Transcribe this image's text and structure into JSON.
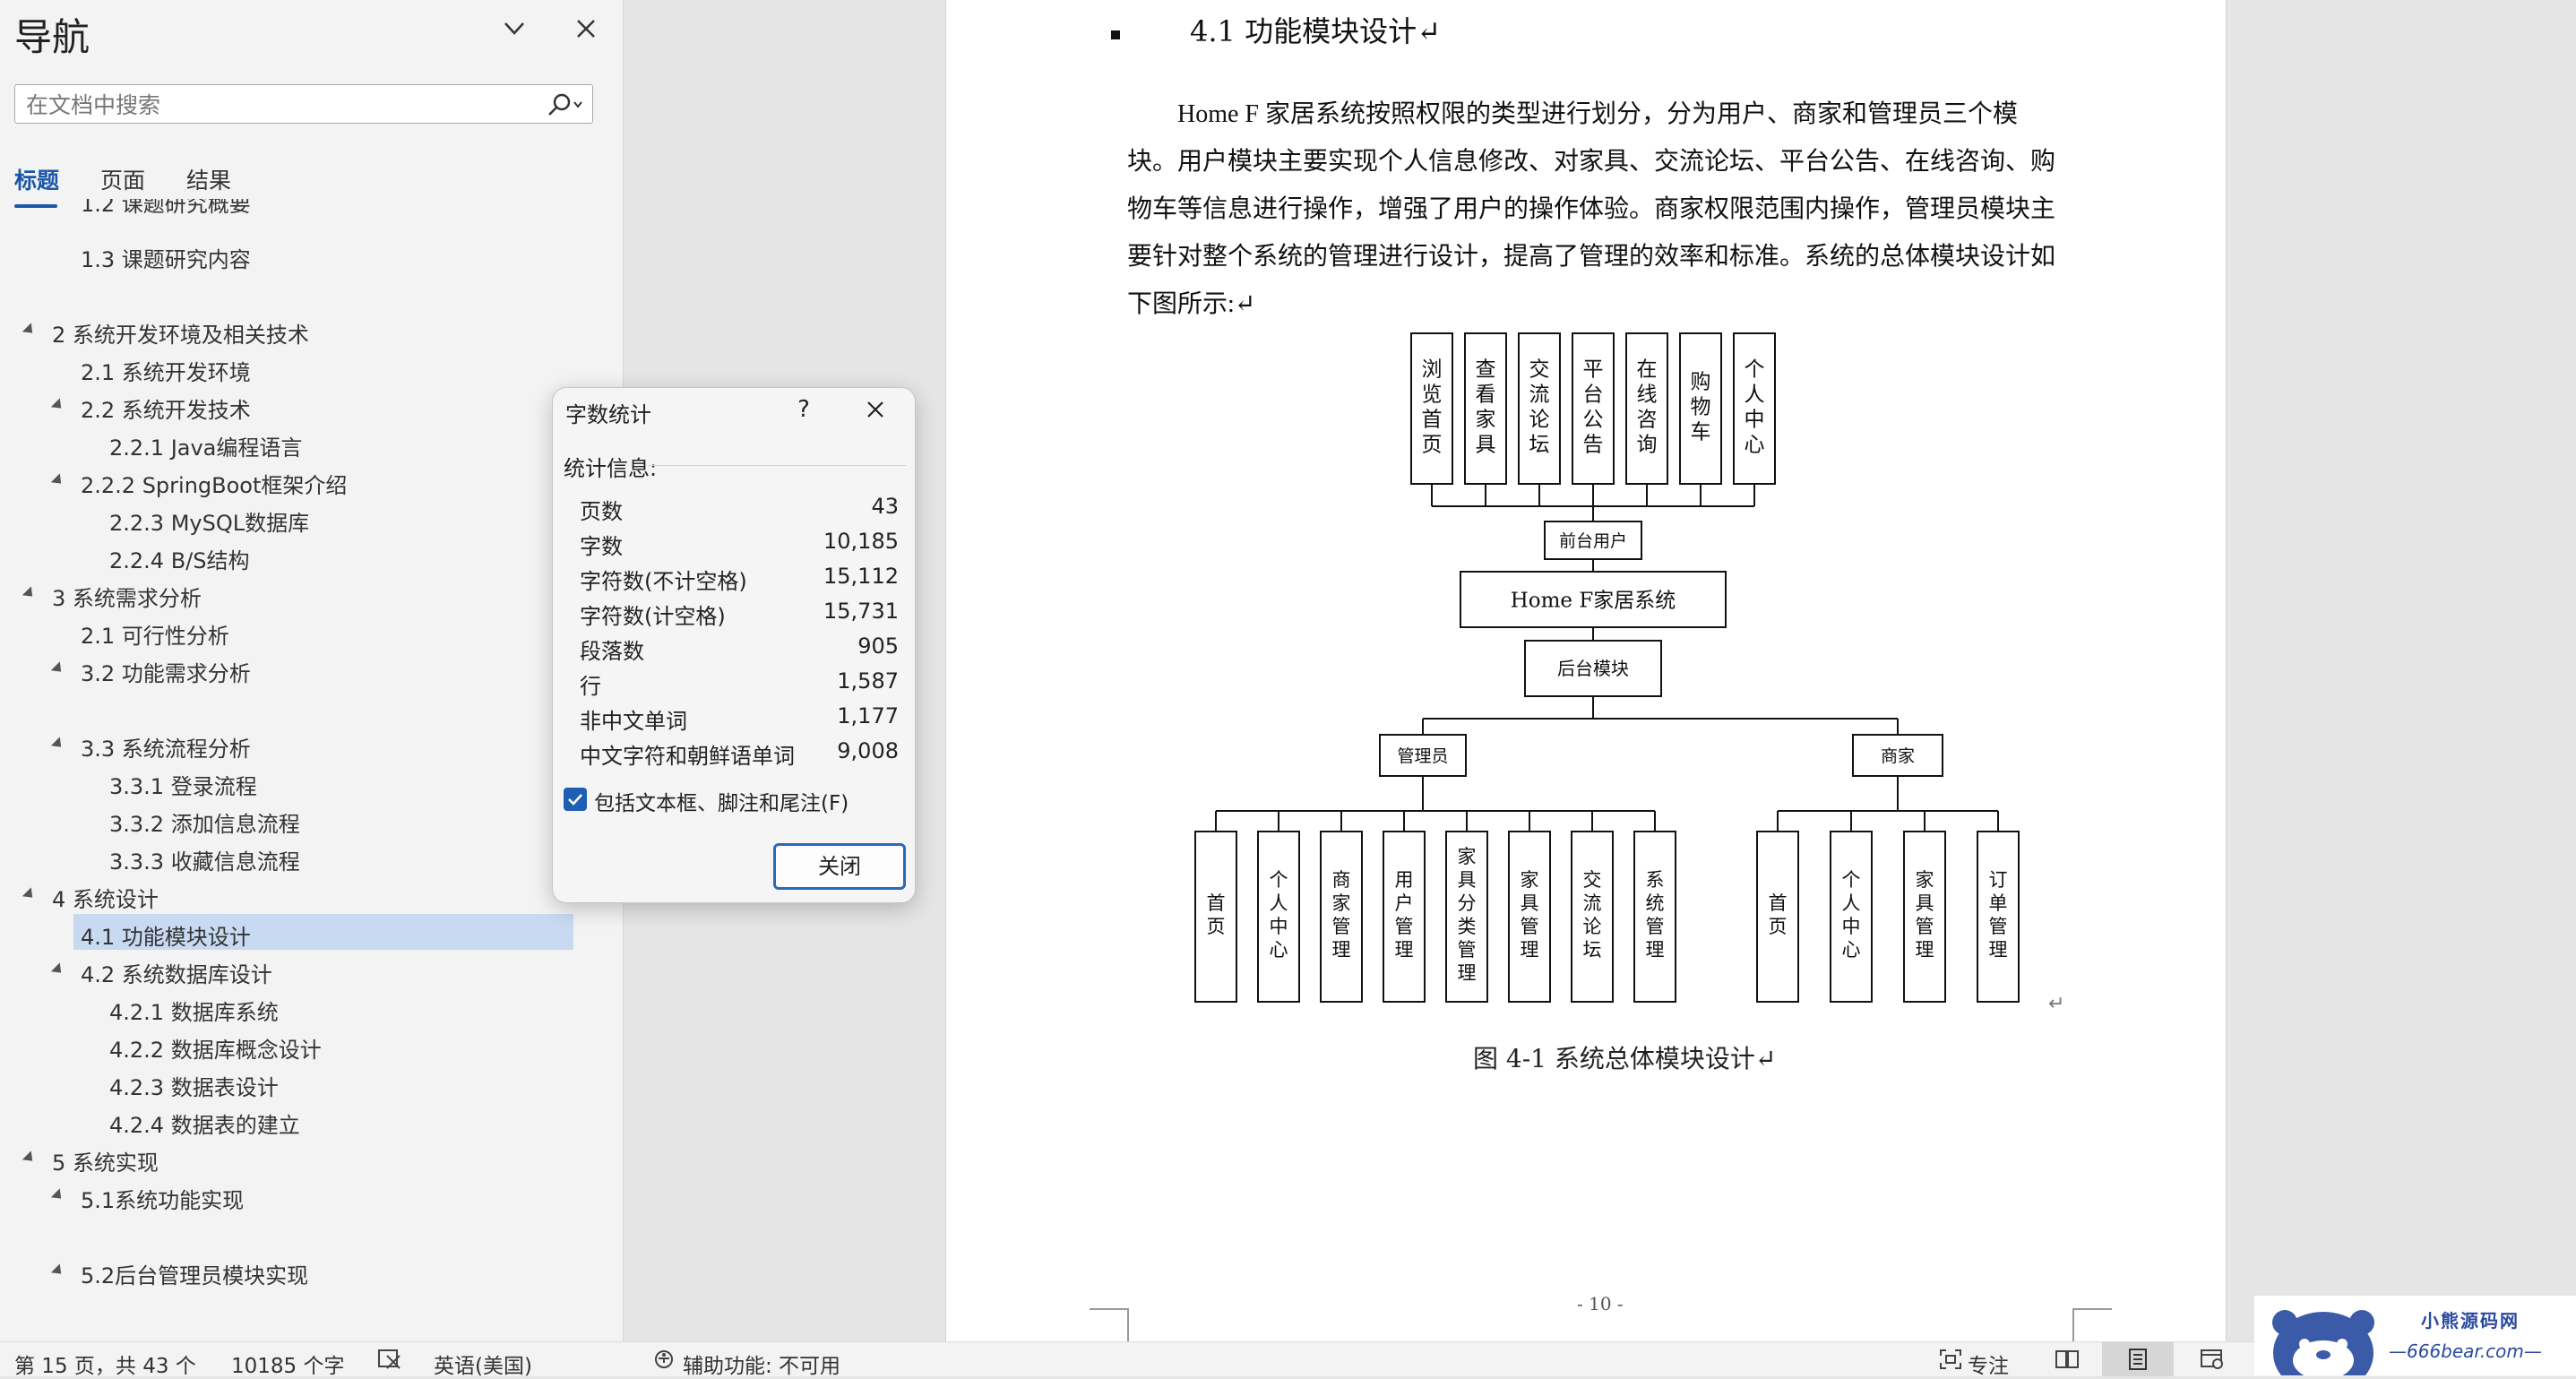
{
  "nav": {
    "title": "导航",
    "search_placeholder": "在文档中搜索",
    "tabs": [
      "标题",
      "页面",
      "结果"
    ],
    "tree": [
      {
        "label": "1.2 课题研究概要",
        "level": 2,
        "arrow": false,
        "partial": true
      },
      {
        "label": "1.3 课题研究内容",
        "level": 2,
        "arrow": false
      },
      {
        "label": "2  系统开发环境及相关技术",
        "level": 1,
        "arrow": true
      },
      {
        "label": "2.1 系统开发环境",
        "level": 2,
        "arrow": false
      },
      {
        "label": "2.2 系统开发技术",
        "level": 2,
        "arrow": true
      },
      {
        "label": "2.2.1 Java编程语言",
        "level": 3,
        "arrow": false
      },
      {
        "label": "2.2.2  SpringBoot框架介绍",
        "level": 2,
        "arrow": true
      },
      {
        "label": "2.2.3 MySQL数据库",
        "level": 3,
        "arrow": false
      },
      {
        "label": "2.2.4 B/S结构",
        "level": 3,
        "arrow": false
      },
      {
        "label": "3  系统需求分析",
        "level": 1,
        "arrow": true
      },
      {
        "label": "2.1 可行性分析",
        "level": 2,
        "arrow": false
      },
      {
        "label": "3.2 功能需求分析",
        "level": 2,
        "arrow": true
      },
      {
        "label": "3.3 系统流程分析",
        "level": 2,
        "arrow": true
      },
      {
        "label": "3.3.1 登录流程",
        "level": 3,
        "arrow": false
      },
      {
        "label": "3.3.2 添加信息流程",
        "level": 3,
        "arrow": false
      },
      {
        "label": "3.3.3 收藏信息流程",
        "level": 3,
        "arrow": false
      },
      {
        "label": "4  系统设计",
        "level": 1,
        "arrow": true
      },
      {
        "label": "4.1 功能模块设计",
        "level": 2,
        "arrow": false,
        "selected": true
      },
      {
        "label": "4.2 系统数据库设计",
        "level": 2,
        "arrow": true
      },
      {
        "label": "4.2.1 数据库系统",
        "level": 3,
        "arrow": false
      },
      {
        "label": "4.2.2 数据库概念设计",
        "level": 3,
        "arrow": false
      },
      {
        "label": "4.2.3 数据表设计",
        "level": 3,
        "arrow": false
      },
      {
        "label": "4.2.4 数据表的建立",
        "level": 3,
        "arrow": false
      },
      {
        "label": "5  系统实现",
        "level": 1,
        "arrow": true
      },
      {
        "label": "5.1系统功能实现",
        "level": 2,
        "arrow": true
      },
      {
        "label": "5.2后台管理员模块实现",
        "level": 2,
        "arrow": true
      }
    ]
  },
  "document": {
    "heading": "4.1  功能模块设计↵",
    "paragraph": "Home F 家居系统按照权限的类型进行划分，分为用户、商家和管理员三个模块。用户模块主要实现个人信息修改、对家具、交流论坛、平台公告、在线咨询、购物车等信息进行操作，增强了用户的操作体验。商家权限范围内操作，管理员模块主要针对整个系统的管理进行设计，提高了管理的效率和标准。系统的总体模块设计如下图所示:↵",
    "figure_caption": "图 4-1  系统总体模块设计↵",
    "page_number": "- 10 -",
    "paragraph_mark": "↵",
    "diagram": {
      "front_modules": [
        "浏览首页",
        "查看家具",
        "交流论坛",
        "平台公告",
        "在线咨询",
        "购物车",
        "个人中心"
      ],
      "front_user": "前台用户",
      "system": "Home F家居系统",
      "backend": "后台模块",
      "admin": "管理员",
      "merchant": "商家",
      "admin_modules": [
        "首页",
        "个人中心",
        "商家管理",
        "用户管理",
        "家具分类管理",
        "家具管理",
        "交流论坛",
        "系统管理"
      ],
      "merchant_modules": [
        "首页",
        "个人中心",
        "家具管理",
        "订单管理"
      ]
    }
  },
  "dialog": {
    "title": "字数统计",
    "help": "?",
    "stats_label": "统计信息:",
    "stats": [
      {
        "k": "页数",
        "v": "43"
      },
      {
        "k": "字数",
        "v": "10,185"
      },
      {
        "k": "字符数(不计空格)",
        "v": "15,112"
      },
      {
        "k": "字符数(计空格)",
        "v": "15,731"
      },
      {
        "k": "段落数",
        "v": "905"
      },
      {
        "k": "行",
        "v": "1,587"
      },
      {
        "k": "非中文单词",
        "v": "1,177"
      },
      {
        "k": "中文字符和朝鲜语单词",
        "v": "9,008"
      }
    ],
    "include_label": "包括文本框、脚注和尾注(F)",
    "include_checked": true,
    "close_label": "关闭"
  },
  "statusbar": {
    "page": "第 15 页，共 43 个",
    "words": "10185 个字",
    "language": "英语(美国)",
    "accessibility": "辅助功能: 不可用",
    "focus": "专注"
  },
  "watermark": {
    "title": "小熊源码网",
    "url": "—666bear.com—"
  },
  "colors": {
    "accent": "#1b57a8",
    "selection": "#c8daf2",
    "nav_bg": "#f3f3f3",
    "doc_bg": "#e5e5e5"
  }
}
